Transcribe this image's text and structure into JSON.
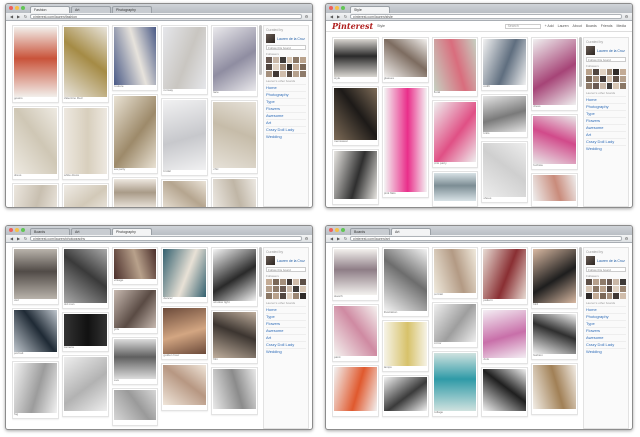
{
  "windows": [
    {
      "id": "w1",
      "tabs": [
        "Fashion",
        "Art",
        "Photography"
      ],
      "active_tab": 0,
      "url": "pinterest.com/lauren/fashion",
      "show_pinterest_header": false,
      "sidebar": {
        "heading": "Curated by",
        "user": "Lauren de la Cruz",
        "follow_box": "Follow this board",
        "followers_heading": "Followers",
        "categories_heading": "Lauren's other boards",
        "categories": [
          "Home",
          "Photography",
          "Type",
          "Flowers",
          "Awesome",
          "Art",
          "Crazy Doll Lady",
          "Wedding"
        ]
      },
      "columns": [
        [
          {
            "h": 70,
            "c1": "#f2efeb",
            "c2": "#c9533a",
            "cap": "gowns"
          },
          {
            "h": 66,
            "c1": "#eeeae2",
            "c2": "#cfc7b5",
            "cap": "dress"
          },
          {
            "h": 30,
            "c1": "#ebe6de",
            "c2": "#c8bfb0",
            "cap": ""
          }
        ],
        [
          {
            "h": 70,
            "c1": "#e8e4dc",
            "c2": "#a58b45",
            "cap": "Valentino Red"
          },
          {
            "h": 66,
            "c1": "#ede8e0",
            "c2": "#d8cfbd",
            "cap": "white dress"
          },
          {
            "h": 30,
            "c1": "#efebe5",
            "c2": "#d2c9b8",
            "cap": ""
          }
        ],
        [
          {
            "h": 58,
            "c1": "#4a5a86",
            "c2": "#e7e3dc",
            "cap": "couture"
          },
          {
            "h": 72,
            "c1": "#e9e2d4",
            "c2": "#9d8a6a",
            "cap": "tea party"
          },
          {
            "h": 30,
            "c1": "#eee8e0",
            "c2": "#a99b88",
            "cap": ""
          }
        ],
        [
          {
            "h": 62,
            "c1": "#e5e6ea",
            "c2": "#c9c6c1",
            "cap": "runway"
          },
          {
            "h": 70,
            "c1": "#f1f1f2",
            "c2": "#c7c8cc",
            "cap": "bridal"
          },
          {
            "h": 30,
            "c1": "#eae3d8",
            "c2": "#b5a58f",
            "cap": ""
          }
        ],
        [
          {
            "h": 64,
            "c1": "#eae9ec",
            "c2": "#8f8da1",
            "cap": "lace"
          },
          {
            "h": 66,
            "c1": "#e6e1d8",
            "c2": "#c6bca9",
            "cap": "chic"
          },
          {
            "h": 30,
            "c1": "#ece8e2",
            "c2": "#c0b6a6",
            "cap": ""
          }
        ]
      ]
    },
    {
      "id": "w2",
      "tabs": [
        "Style"
      ],
      "active_tab": 0,
      "url": "pinterest.com/lauren/style",
      "show_pinterest_header": true,
      "pinterest": {
        "logo": "Pinterest",
        "search_placeholder": "Search",
        "nav": [
          "+ Add",
          "Lauren",
          "About",
          "Boards",
          "Friends",
          "Media"
        ],
        "board_title": "Style"
      },
      "sidebar": {
        "heading": "Curated by",
        "user": "Lauren de la Cruz",
        "follow_box": "Follow this board",
        "followers_heading": "Followers",
        "categories_heading": "Lauren's other boards",
        "categories": [
          "Home",
          "Photography",
          "Type",
          "Flowers",
          "Awesome",
          "Art",
          "Crazy Doll Lady",
          "Wedding"
        ]
      },
      "columns": [
        [
          {
            "h": 38,
            "c1": "#d9d6d1",
            "c2": "#2b2b2b",
            "cap": "style"
          },
          {
            "h": 52,
            "c1": "#7d6b57",
            "c2": "#1d1a18",
            "cap": "menswear"
          },
          {
            "h": 48,
            "c1": "#e8e6e2",
            "c2": "#2f2f2f",
            "cap": ""
          }
        ],
        [
          {
            "h": 38,
            "c1": "#f2f0ee",
            "c2": "#7d6c60",
            "cap": "glasses"
          },
          {
            "h": 104,
            "c1": "#f4f4f4",
            "c2": "#e92e8a",
            "cap": "pink flats"
          }
        ],
        [
          {
            "h": 52,
            "c1": "#c6d1c2",
            "c2": "#d96d7d",
            "cap": "floral"
          },
          {
            "h": 60,
            "c1": "#efefef",
            "c2": "#e05085",
            "cap": "pink party"
          },
          {
            "h": 28,
            "c1": "#d8e2e6",
            "c2": "#7c8d94",
            "cap": ""
          }
        ],
        [
          {
            "h": 46,
            "c1": "#f2f2f2",
            "c2": "#5f6e7f",
            "cap": "outfit"
          },
          {
            "h": 36,
            "c1": "#e5e5e5",
            "c2": "#7a7a7a",
            "cap": "knits"
          },
          {
            "h": 54,
            "c1": "#ededed",
            "c2": "#cfcfcf",
            "cap": "shoes"
          }
        ],
        [
          {
            "h": 66,
            "c1": "#f0f0f0",
            "c2": "#a64477",
            "cap": "dress"
          },
          {
            "h": 48,
            "c1": "#e9e9e9",
            "c2": "#d14a8a",
            "cap": "fuchsia"
          },
          {
            "h": 26,
            "c1": "#efefef",
            "c2": "#c98b7b",
            "cap": ""
          }
        ]
      ]
    },
    {
      "id": "w3",
      "tabs": [
        "Boards",
        "Art",
        "Photography"
      ],
      "active_tab": 2,
      "url": "pinterest.com/lauren/photography",
      "show_pinterest_header": false,
      "sidebar": {
        "heading": "Curated by",
        "user": "Lauren de la Cruz",
        "follow_box": "Follow this board",
        "followers_heading": "Followers",
        "categories_heading": "Lauren's other boards",
        "categories": [
          "Home",
          "Type",
          "Flowers",
          "Awesome",
          "Art",
          "Crazy Doll Lady",
          "Wedding"
        ]
      },
      "columns": [
        [
          {
            "h": 50,
            "c1": "#b9b3ab",
            "c2": "#514b47",
            "cap": "owl"
          },
          {
            "h": 42,
            "c1": "#bfc6cd",
            "c2": "#1f2a35",
            "cap": "portrait"
          },
          {
            "h": 50,
            "c1": "#f2f2f2",
            "c2": "#9c9c9c",
            "cap": "fog"
          }
        ],
        [
          {
            "h": 54,
            "c1": "#a9a9a9",
            "c2": "#3a3a3a",
            "cap": "old man"
          },
          {
            "h": 32,
            "c1": "#333333",
            "c2": "#111111",
            "cap": "camera"
          },
          {
            "h": 54,
            "c1": "#eeeeee",
            "c2": "#b2b2b2",
            "cap": ""
          }
        ],
        [
          {
            "h": 30,
            "c1": "#4a2e2a",
            "c2": "#b8a18b",
            "cap": "vintage"
          },
          {
            "h": 38,
            "c1": "#c7b9b0",
            "c2": "#5a4b44",
            "cap": "girls"
          },
          {
            "h": 40,
            "c1": "#dcdcdc",
            "c2": "#5f5f5f",
            "cap": "love"
          },
          {
            "h": 30,
            "c1": "#d6d6d6",
            "c2": "#9a9a9a",
            "cap": ""
          }
        ],
        [
          {
            "h": 48,
            "c1": "#33606f",
            "c2": "#e8e1d6",
            "cap": "dancer"
          },
          {
            "h": 46,
            "c1": "#6b4a3a",
            "c2": "#d3a682",
            "cap": "golden hour"
          },
          {
            "h": 40,
            "c1": "#f0e6da",
            "c2": "#b79782",
            "cap": ""
          }
        ],
        [
          {
            "h": 52,
            "c1": "#f5f5f5",
            "c2": "#2a2a2a",
            "cap": "window light"
          },
          {
            "h": 46,
            "c1": "#bfae9d",
            "c2": "#3c3530",
            "cap": "film"
          },
          {
            "h": 40,
            "c1": "#e9e9e9",
            "c2": "#8b8b8b",
            "cap": ""
          }
        ]
      ]
    },
    {
      "id": "w4",
      "tabs": [
        "Boards",
        "Art"
      ],
      "active_tab": 1,
      "url": "pinterest.com/lauren/art",
      "show_pinterest_header": false,
      "sidebar": {
        "heading": "Curated by",
        "user": "Lauren de la Cruz",
        "follow_box": "Follow this board",
        "followers_heading": "Followers",
        "categories_heading": "Lauren's other boards",
        "categories": [
          "Home",
          "Photography",
          "Type",
          "Flowers",
          "Awesome",
          "Crazy Doll Lady",
          "Wedding"
        ]
      },
      "columns": [
        [
          {
            "h": 46,
            "c1": "#f3f1ee",
            "c2": "#8e7d86",
            "cap": "sketch"
          },
          {
            "h": 50,
            "c1": "#f5f3f0",
            "c2": "#cf8aa2",
            "cap": "paint"
          },
          {
            "h": 44,
            "c1": "#f2f2f2",
            "c2": "#e0592e",
            "cap": ""
          }
        ],
        [
          {
            "h": 62,
            "c1": "#f3f3f3",
            "c2": "#6d6d6d",
            "cap": "illustration"
          },
          {
            "h": 44,
            "c1": "#f6f3e7",
            "c2": "#d7c26a",
            "cap": "lamps"
          },
          {
            "h": 34,
            "c1": "#f2f2f2",
            "c2": "#3b3b3b",
            "cap": ""
          }
        ],
        [
          {
            "h": 44,
            "c1": "#f0eadd",
            "c2": "#b39a84",
            "cap": "portrait"
          },
          {
            "h": 38,
            "c1": "#efefef",
            "c2": "#9e9e9e",
            "cap": "mirror"
          },
          {
            "h": 58,
            "c1": "#cfe2df",
            "c2": "#2f9aa7",
            "cap": "collage"
          }
        ],
        [
          {
            "h": 50,
            "c1": "#e8dcd4",
            "c2": "#8a2f33",
            "cap": "pattern"
          },
          {
            "h": 48,
            "c1": "#f4eef4",
            "c2": "#c86fa9",
            "cap": "dots"
          },
          {
            "h": 42,
            "c1": "#f1f1f1",
            "c2": "#1f1f1f",
            "cap": ""
          }
        ],
        [
          {
            "h": 54,
            "c1": "#d9b9a2",
            "c2": "#1e1e1e",
            "cap": "bird"
          },
          {
            "h": 40,
            "c1": "#f4f4f4",
            "c2": "#2f2f2f",
            "cap": "fashion"
          },
          {
            "h": 44,
            "c1": "#f2ede6",
            "c2": "#a18056",
            "cap": ""
          }
        ]
      ]
    }
  ],
  "mosaic_colors": [
    "#6b5b53",
    "#c9b8a8",
    "#3e3a38",
    "#d7c6b4",
    "#8a7765",
    "#b9a28c",
    "#514640",
    "#e1d3c4",
    "#9c8774",
    "#2f2b29",
    "#c3ab95",
    "#7a6858",
    "#a48f7c",
    "#403835",
    "#d0bdab",
    "#5d4f46",
    "#b5a08c",
    "#8e7b6a"
  ]
}
